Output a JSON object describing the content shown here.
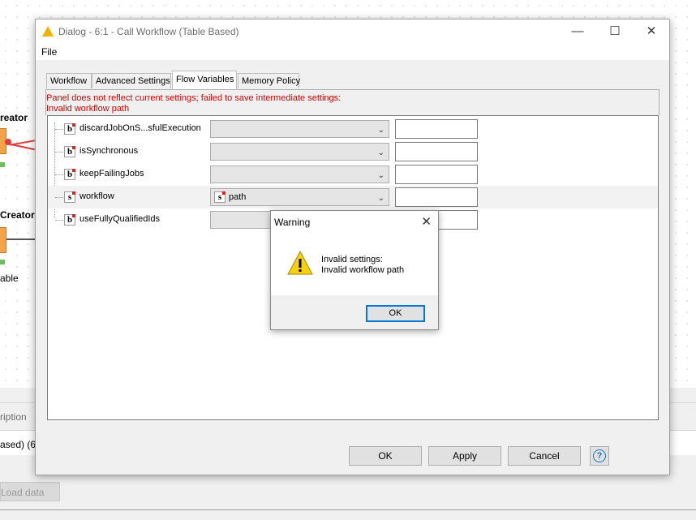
{
  "background": {
    "node1_label": "reator",
    "node2_label": "Creator",
    "node2_sublabel": "able",
    "description_tab": "ription",
    "console_text": "ased)  (6",
    "load_button": "Load data"
  },
  "dialog": {
    "title": "Dialog - 6:1 - Call Workflow (Table Based)",
    "menu_file": "File",
    "tabs": [
      "Workflow",
      "Advanced Settings",
      "Flow Variables",
      "Memory Policy"
    ],
    "active_tab": "Flow Variables",
    "error_lines": [
      "Panel does not reflect current settings; failed to save intermediate settings:",
      "Invalid workflow path"
    ],
    "rows": [
      {
        "type": "b",
        "name": "discardJobOnS...sfulExecution",
        "variable": "",
        "value": ""
      },
      {
        "type": "b",
        "name": "isSynchronous",
        "variable": "",
        "value": ""
      },
      {
        "type": "b",
        "name": "keepFailingJobs",
        "variable": "",
        "value": ""
      },
      {
        "type": "s",
        "name": "workflow",
        "variable": "path",
        "variable_type": "s",
        "value": ""
      },
      {
        "type": "b",
        "name": "useFullyQualifiedIds",
        "variable": "",
        "value": ""
      }
    ],
    "buttons": {
      "ok": "OK",
      "apply": "Apply",
      "cancel": "Cancel",
      "help": "?"
    }
  },
  "warning": {
    "title": "Warning",
    "message_line1": "Invalid settings:",
    "message_line2": "Invalid workflow path",
    "ok": "OK",
    "icon": "warning-icon"
  },
  "colors": {
    "error_text": "#d40000",
    "focus_border": "#0078d7",
    "warning_icon": "#f7d20c",
    "help_blue": "#1a73c8",
    "logo": "#f0b400"
  }
}
